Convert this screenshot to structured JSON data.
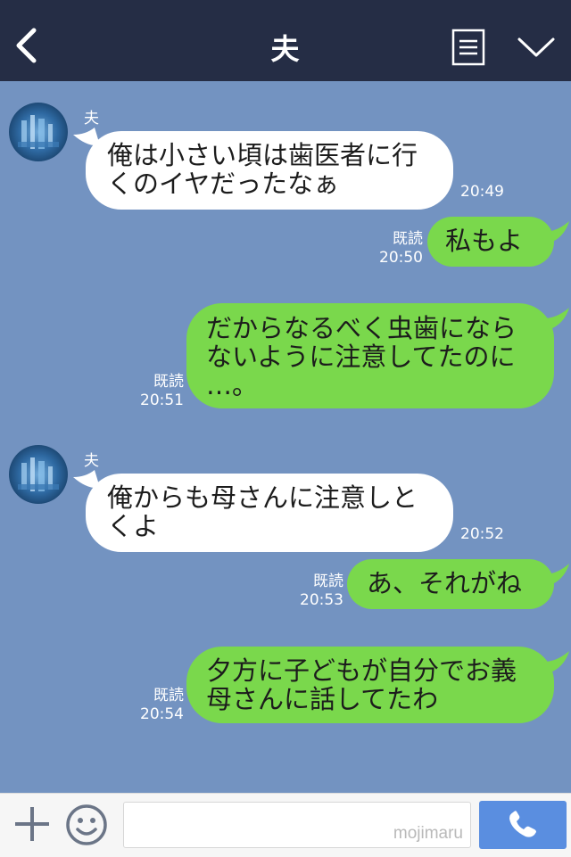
{
  "header": {
    "title": "夫",
    "back_icon": "chevron-left-icon",
    "menu_icon": "menu-icon",
    "collapse_icon": "chevron-down-icon",
    "background": "#252d45"
  },
  "chat": {
    "background": "#7393c1",
    "incoming_color": "#ffffff",
    "outgoing_color": "#7ad84c",
    "messages": [
      {
        "direction": "in",
        "sender": "夫",
        "text": "俺は小さい頃は歯医者に行\nくのイヤだったなぁ",
        "time": "20:49"
      },
      {
        "direction": "out",
        "read": "既読",
        "text": "私もよ",
        "time": "20:50"
      },
      {
        "direction": "out",
        "read": "既読",
        "text": "だからなるべく虫歯になら\nないように注意してたのに\n…。",
        "time": "20:51"
      },
      {
        "direction": "in",
        "sender": "夫",
        "text": "俺からも母さんに注意しと\nくよ",
        "time": "20:52"
      },
      {
        "direction": "out",
        "read": "既読",
        "text": "あ、それがね",
        "time": "20:53"
      },
      {
        "direction": "out",
        "read": "既読",
        "text": "夕方に子どもが自分でお義\n母さんに話してたわ",
        "time": "20:54"
      }
    ]
  },
  "footer": {
    "plus_icon": "plus-icon",
    "emoji_icon": "emoji-icon",
    "input_value": "",
    "watermark": "mojimaru",
    "call_icon": "phone-icon",
    "call_color": "#5a8ee0"
  }
}
